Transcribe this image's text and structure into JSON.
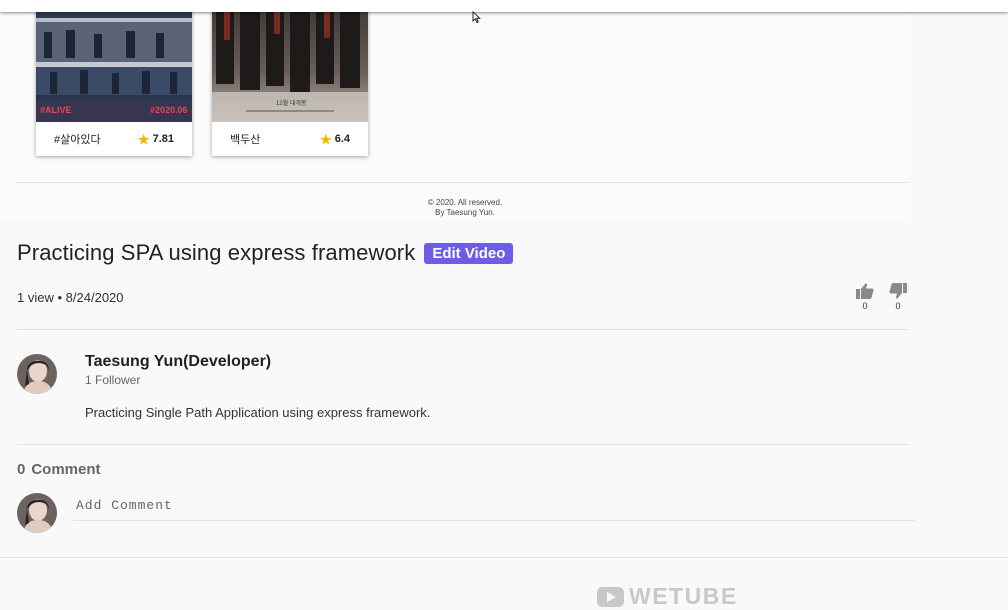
{
  "movies": [
    {
      "title": "#살아있다",
      "rating": "7.81",
      "poster_text_left": "#ALIVE",
      "poster_text_right": "#2020.06"
    },
    {
      "title": "백두산",
      "rating": "6.4",
      "poster_text": "12월 대개봉"
    }
  ],
  "frame_footer": {
    "copyright": "© 2020. All reserved.",
    "byline": "By Taesung Yun."
  },
  "video": {
    "title": "Practicing SPA using express framework",
    "edit_label": "Edit Video",
    "views": "1 view",
    "separator": "•",
    "date": "8/24/2020",
    "likes": "0",
    "dislikes": "0"
  },
  "creator": {
    "name": "Taesung Yun(Developer)",
    "followers": "1 Follower",
    "description": "Practicing Single Path Application using express framework."
  },
  "comments": {
    "count": "0",
    "label": "Comment",
    "placeholder": "Add Comment"
  },
  "footer": {
    "logo_text": "WETUBE"
  },
  "colors": {
    "accent": "#6c5ce7",
    "star": "#f5b400",
    "logo": "#c8c8c8"
  }
}
